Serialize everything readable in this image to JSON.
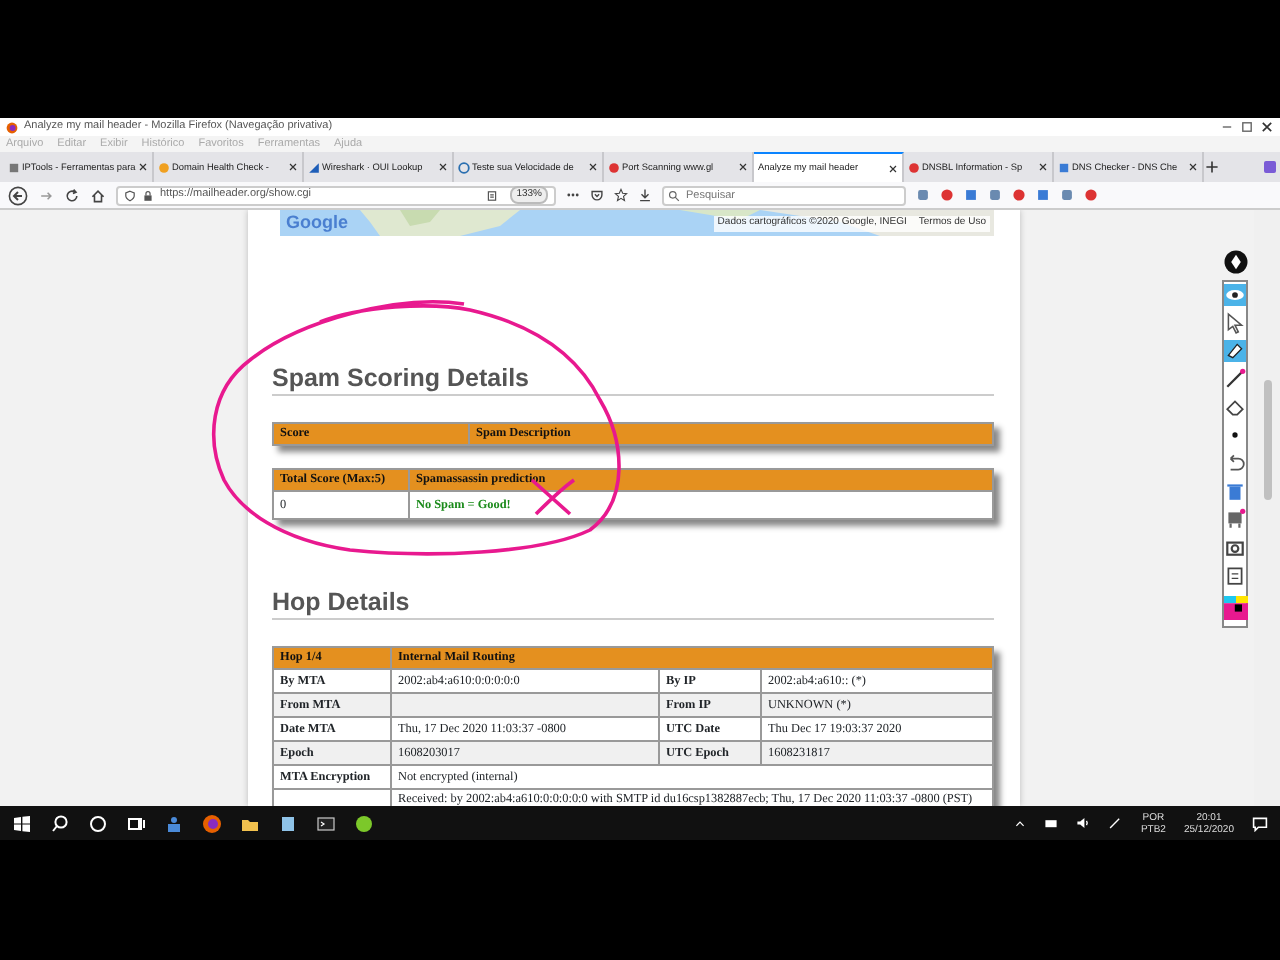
{
  "window": {
    "title": "Analyze my mail header - Mozilla Firefox (Navegação privativa)"
  },
  "menu": [
    "Arquivo",
    "Editar",
    "Exibir",
    "Histórico",
    "Favoritos",
    "Ferramentas",
    "Ajuda"
  ],
  "tabs": [
    {
      "label": "IPTools - Ferramentas para",
      "selected": false
    },
    {
      "label": "Domain Health Check -",
      "selected": false
    },
    {
      "label": "Wireshark · OUI Lookup",
      "selected": false
    },
    {
      "label": "Teste sua Velocidade de",
      "selected": false
    },
    {
      "label": "Port Scanning www.gl",
      "selected": false
    },
    {
      "label": "Analyze my mail header",
      "selected": true
    },
    {
      "label": "DNSBL Information - Sp",
      "selected": false
    },
    {
      "label": "DNS Checker - DNS Che",
      "selected": false
    }
  ],
  "toolbar": {
    "url": "https://mailheader.org/show.cgi",
    "zoom": "133%",
    "search_placeholder": "Pesquisar"
  },
  "map": {
    "logo": "Google",
    "attribution": "Dados cartográficos ©2020 Google, INEGI",
    "terms": "Termos de Uso"
  },
  "spam": {
    "heading": "Spam Scoring Details",
    "score_columns": [
      "Score",
      "Spam Description"
    ],
    "result_columns": [
      "Total Score (Max:5)",
      "Spamassassin prediction"
    ],
    "result_row": [
      "0",
      "No Spam = Good!"
    ]
  },
  "hop": {
    "heading": "Hop Details",
    "header": [
      "Hop 1/4",
      "Internal Mail Routing"
    ],
    "rows": [
      [
        "By MTA",
        "2002:ab4:a610:0:0:0:0:0",
        "By IP",
        "2002:ab4:a610:: (*)"
      ],
      [
        "From MTA",
        null,
        "From IP",
        "UNKNOWN (*)"
      ],
      [
        "Date MTA",
        "Thu, 17 Dec 2020 11:03:37 -0800",
        "UTC Date",
        "Thu Dec 17 19:03:37 2020"
      ],
      [
        "Epoch",
        "1608203017",
        "UTC Epoch",
        "1608231817"
      ]
    ],
    "encryption": [
      "MTA Encryption",
      "Not encrypted (internal)"
    ],
    "received": "Received: by 2002:ab4:a610:0:0:0:0:0 with SMTP id du16csp1382887ecb; Thu, 17 Dec 2020 11:03:37 -0800 (PST)"
  },
  "taskbar": {
    "language": "POR",
    "layout": "PTB2",
    "time": "20:01",
    "date": "25/12/2020"
  }
}
